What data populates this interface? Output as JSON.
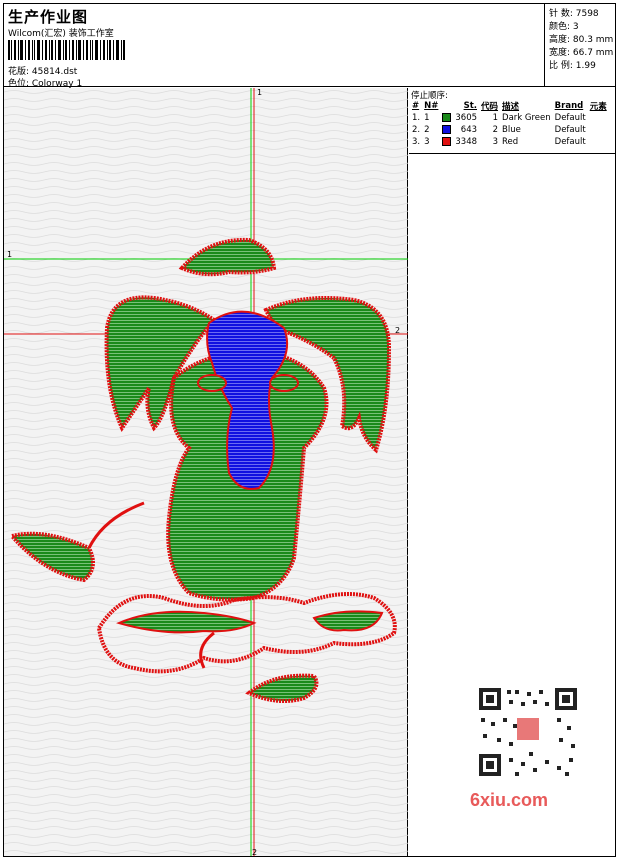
{
  "header": {
    "title": "生产作业图",
    "company": "Wilcom(汇宏) 装饰工作室",
    "design_label": "花版: 45814.dst",
    "colorway_label": "色位: Colorway 1"
  },
  "stats": [
    {
      "label": "针 数: 7598"
    },
    {
      "label": "颜色: 3"
    },
    {
      "label": "高度: 80.3 mm"
    },
    {
      "label": "宽度: 66.7 mm"
    },
    {
      "label": "比 例: 1.99"
    }
  ],
  "stop_sequence": {
    "title": "停止顺序:",
    "headers": [
      "#",
      "N#",
      "St.",
      "代码",
      "描述",
      "Brand",
      "元素"
    ],
    "rows": [
      {
        "num": "1.",
        "n": "1",
        "color": "#1a8a1a",
        "stitches": "3605",
        "code": "1",
        "desc": "Dark Green",
        "brand": "Default"
      },
      {
        "num": "2.",
        "n": "2",
        "color": "#1010e0",
        "stitches": "643",
        "code": "2",
        "desc": "Blue",
        "brand": "Default"
      },
      {
        "num": "3.",
        "n": "3",
        "color": "#e01010",
        "stitches": "3348",
        "code": "3",
        "desc": "Red",
        "brand": "Default"
      }
    ]
  },
  "guides": {
    "v1": "1",
    "v2": "2",
    "h1": "1",
    "h2": "2"
  },
  "watermark": "6xiu.com",
  "colors": {
    "green": "#1a8a1a",
    "blue": "#1010e0",
    "red": "#e01010",
    "guide_green": "#00cc00",
    "guide_red": "#e01010"
  }
}
